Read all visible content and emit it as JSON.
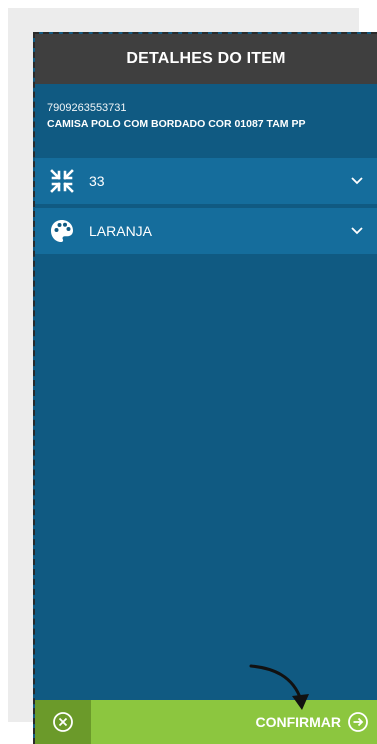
{
  "header": {
    "title": "DETALHES DO ITEM"
  },
  "item": {
    "code": "7909263553731",
    "description": "CAMISA POLO COM BORDADO COR 01087 TAM PP"
  },
  "selects": {
    "size": {
      "value": "33",
      "icon": "compress-arrows-icon"
    },
    "color": {
      "value": "LARANJA",
      "icon": "palette-icon"
    }
  },
  "footer": {
    "cancel_icon": "close-circle-icon",
    "confirm_label": "CONFIRMAR",
    "confirm_icon": "arrow-right-circle-icon"
  },
  "colors": {
    "header_bg": "#3f3f3f",
    "panel_bg": "#105a82",
    "select_bg": "#156d9c",
    "cancel_bg": "#6b9a2a",
    "confirm_bg": "#8cc63f"
  }
}
